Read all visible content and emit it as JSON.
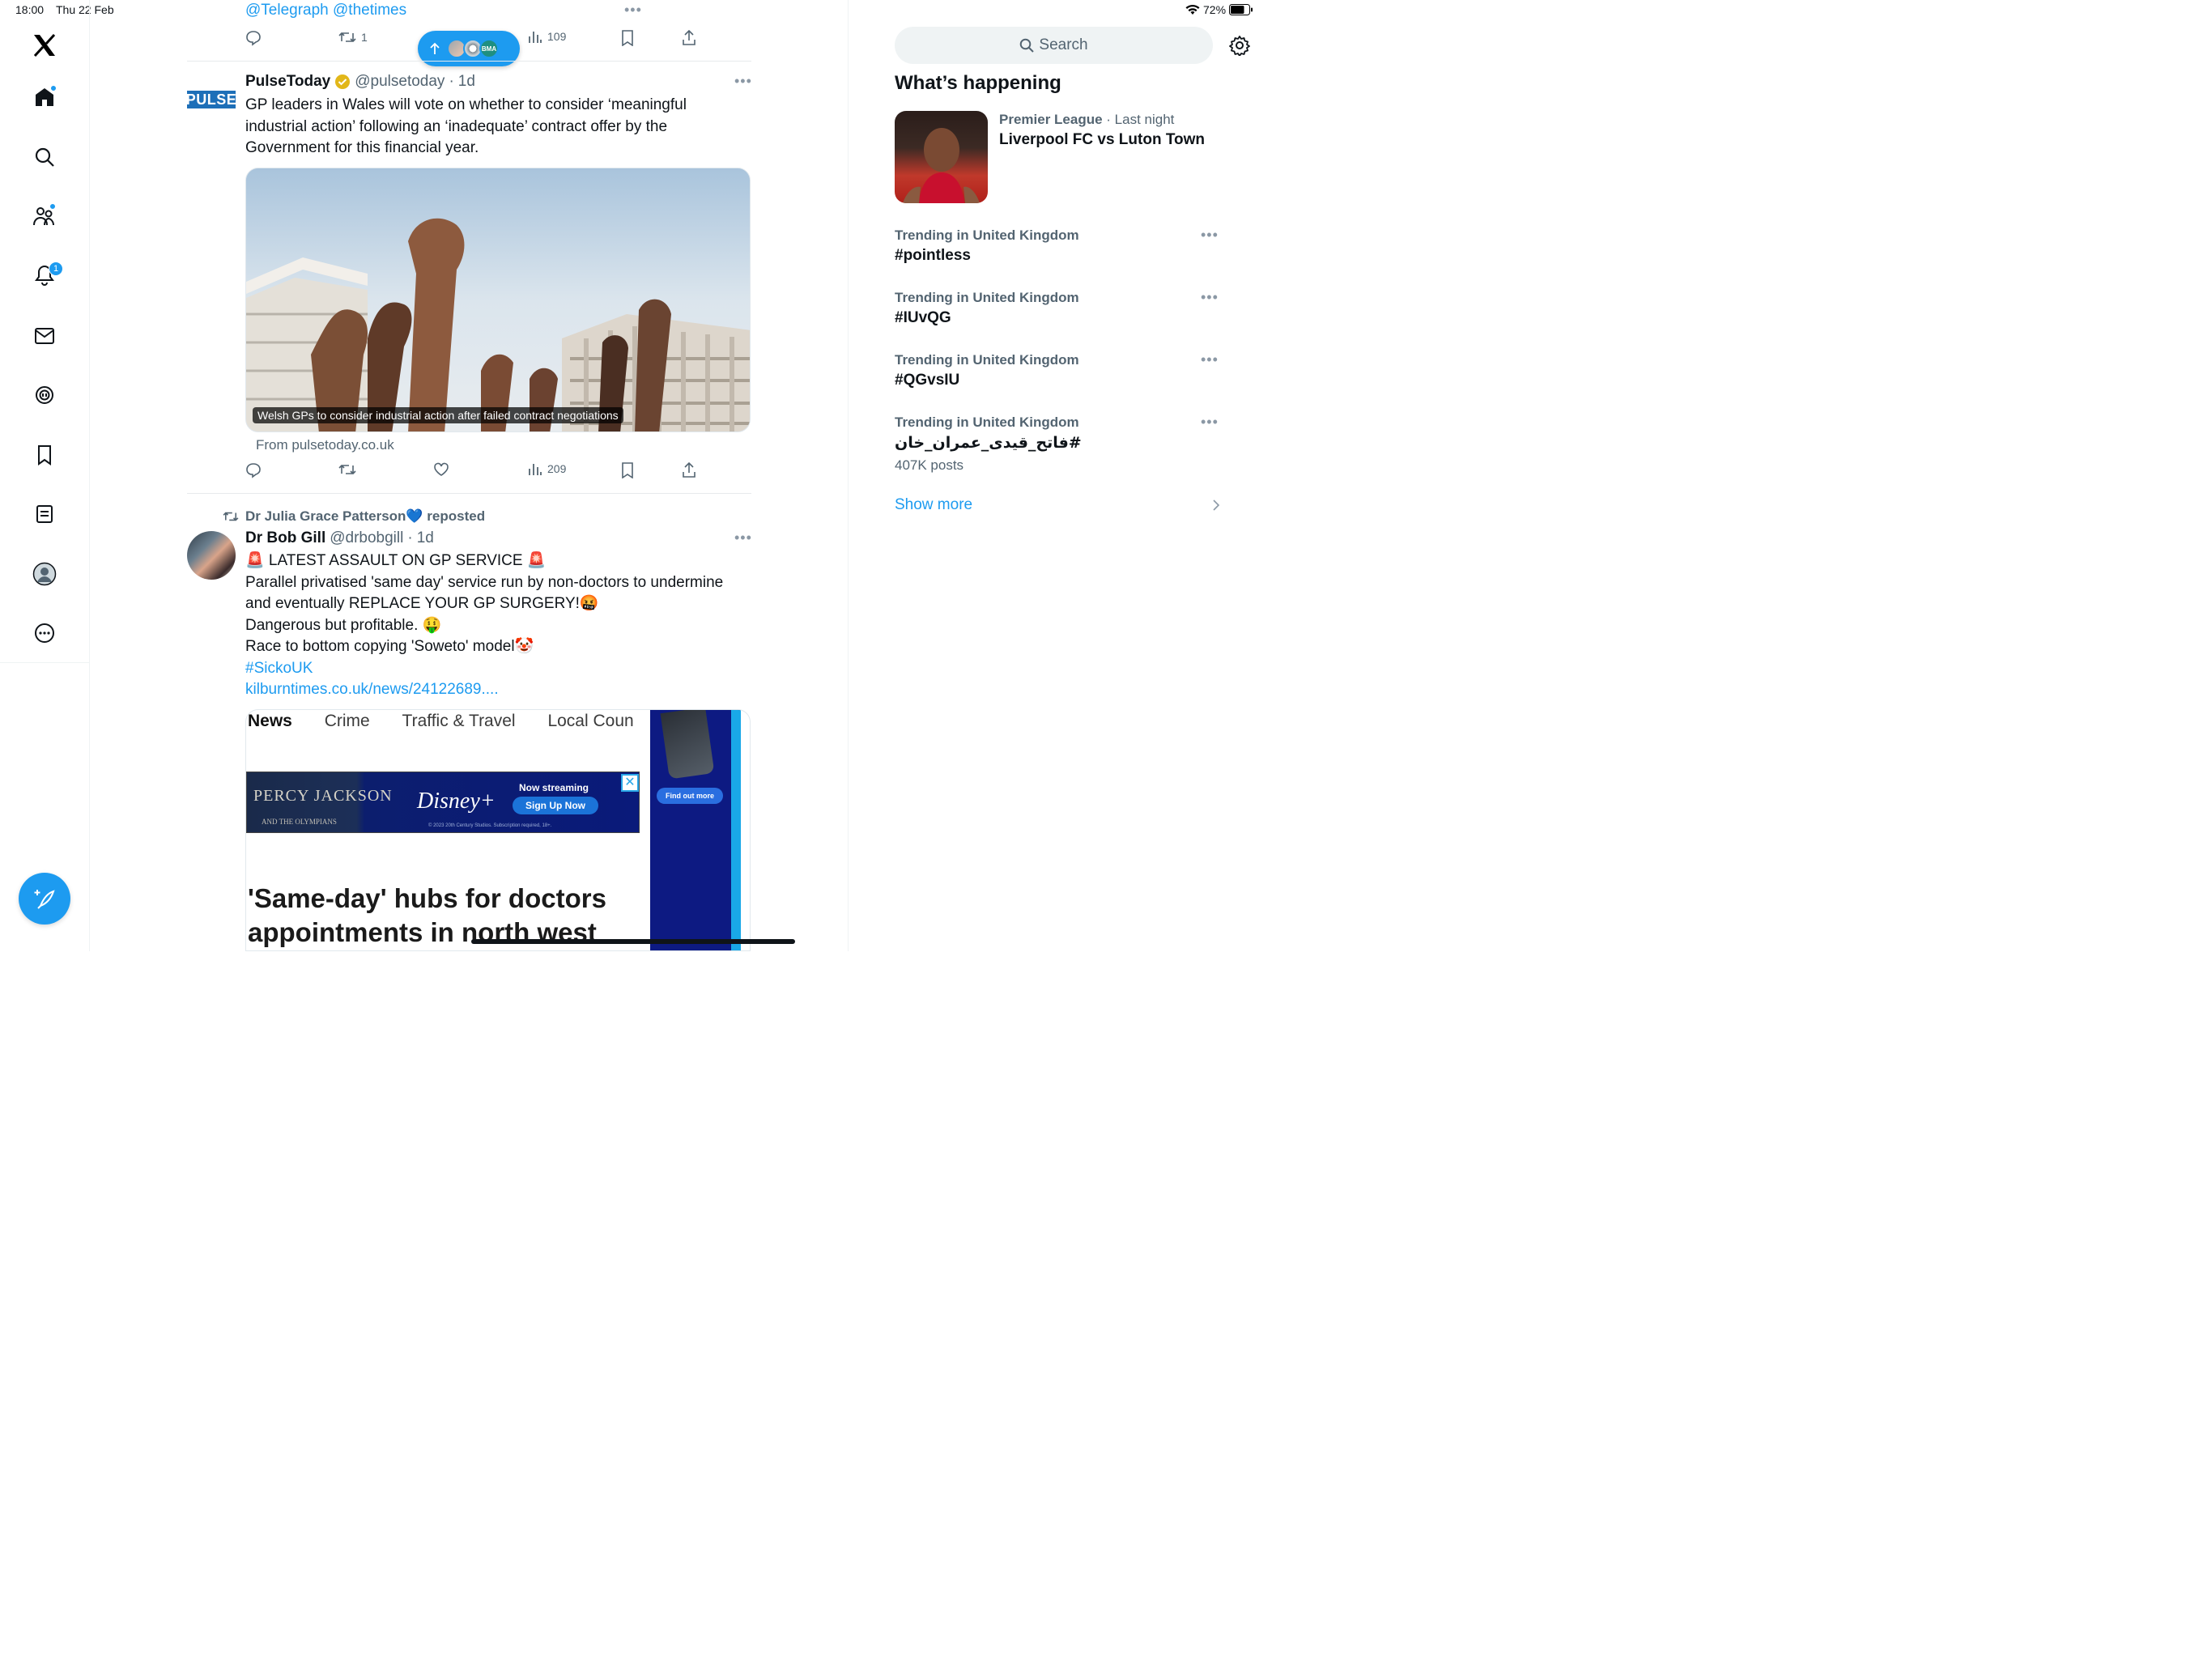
{
  "status_bar": {
    "time": "18:00",
    "date": "Thu 22 Feb",
    "battery": "72%"
  },
  "nav": {
    "notifications_badge": "1",
    "accent": "#1d9bf0"
  },
  "top_tweet_tail": {
    "mentions": "@Telegraph @thetimes",
    "retweets": "1",
    "views": "109"
  },
  "new_posts_pill": {
    "avatar_label": "BMA"
  },
  "tweet1": {
    "name": "PulseToday",
    "handle": "@pulsetoday",
    "sep": "·",
    "time": "1d",
    "avatar_text": "PULSE",
    "text_lines": [
      "GP leaders in Wales will vote on whether to consider ‘meaningful",
      "industrial action’ following an ‘inadequate’ contract offer by the",
      "Government for this financial year."
    ],
    "card_caption": "Welsh GPs to consider industrial action after failed contract negotiations",
    "card_source": "From pulsetoday.co.uk",
    "views": "209"
  },
  "tweet2": {
    "reposted_by": "Dr Julia Grace Patterson💙 reposted",
    "name": "Dr Bob Gill",
    "handle": "@drbobgill",
    "sep": "·",
    "time": "1d",
    "lines": [
      "🚨 LATEST ASSAULT ON GP SERVICE 🚨",
      "Parallel privatised 'same day' service run by non-doctors to undermine",
      "and eventually REPLACE YOUR GP SURGERY!🤬",
      "Dangerous but profitable. 🤑",
      "Race to bottom copying 'Soweto' model🤡"
    ],
    "hashtag": "#SickoUK",
    "link": "kilburntimes.co.uk/news/24122689....",
    "article": {
      "nav": [
        "News",
        "Crime",
        "Traffic & Travel",
        "Local Coun"
      ],
      "ad_left": "PERCY JACKSON",
      "ad_left_sub": "AND THE OLYMPIANS",
      "ad_brand": "Disney+",
      "ad_now": "Now streaming",
      "ad_cta": "Sign Up Now",
      "ad_fine": "© 2023 20th Century Studios. Subscription required, 18+.",
      "side_cta": "Find out more",
      "headline_1": "'Same-day' hubs for doctors",
      "headline_2": "appointments in north west"
    }
  },
  "sidebar": {
    "search_placeholder": "Search",
    "heading": "What’s happening",
    "featured": {
      "category": "Premier League",
      "when": "· Last night",
      "title": "Liverpool FC vs Luton Town"
    },
    "trends": [
      {
        "context": "Trending in United Kingdom",
        "name": "#pointless",
        "posts": ""
      },
      {
        "context": "Trending in United Kingdom",
        "name": "#IUvQG",
        "posts": ""
      },
      {
        "context": "Trending in United Kingdom",
        "name": "#QGvsIU",
        "posts": ""
      },
      {
        "context": "Trending in United Kingdom",
        "name": "#فاتح_قیدی_عمران_خان",
        "posts": "407K posts"
      }
    ],
    "show_more": "Show more"
  }
}
